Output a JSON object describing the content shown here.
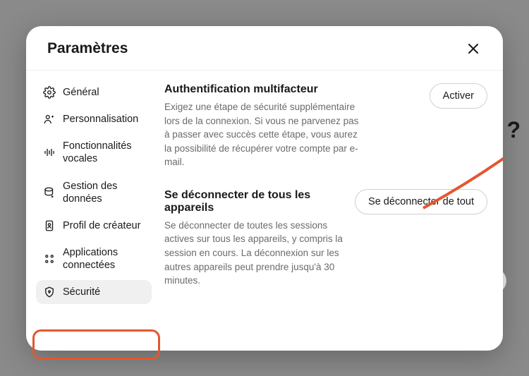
{
  "modal": {
    "title": "Paramètres"
  },
  "sidebar": {
    "items": [
      {
        "label": "Général"
      },
      {
        "label": "Personnalisation"
      },
      {
        "label": "Fonctionnalités vocales"
      },
      {
        "label": "Gestion des données"
      },
      {
        "label": "Profil de créateur"
      },
      {
        "label": "Applications connectées"
      },
      {
        "label": "Sécurité"
      }
    ]
  },
  "content": {
    "mfa": {
      "title": "Authentification multifacteur",
      "desc": "Exigez une étape de sécurité supplémentaire lors de la connexion. Si vous ne parvenez pas à passer avec succès cette étape, vous aurez la possibilité de récupérer votre compte par e-mail.",
      "button": "Activer"
    },
    "logout": {
      "title": "Se déconnecter de tous les appareils",
      "desc": "Se déconnecter de toutes les sessions actives sur tous les appareils, y compris la session en cours. La déconnexion sur les autres appareils peut prendre jusqu'à 30 minutes.",
      "button": "Se déconnecter de tout"
    }
  },
  "bg": {
    "qmark": "?"
  }
}
